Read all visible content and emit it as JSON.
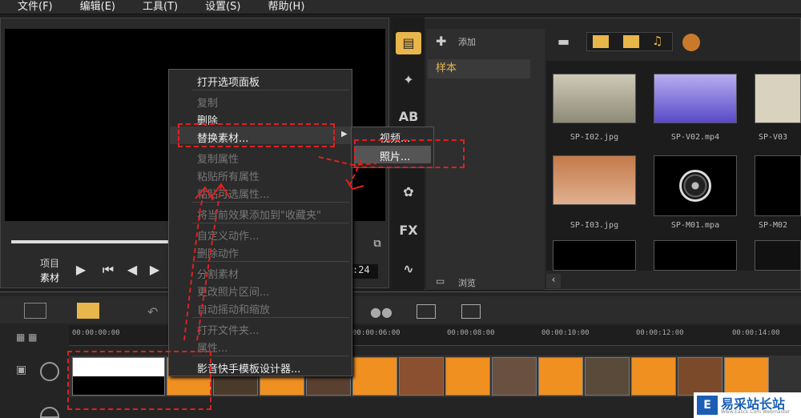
{
  "menubar": {
    "items": [
      "文件(F)",
      "编辑(E)",
      "工具(T)",
      "设置(S)",
      "帮助(H)"
    ]
  },
  "preview": {
    "project_label": "项目",
    "clip_label": "素材",
    "timecode_tail": ":24"
  },
  "library": {
    "add_label": "添加",
    "sample_label": "样本",
    "browse_label": "浏览",
    "thumbnails": [
      "SP-I02.jpg",
      "SP-V02.mp4",
      "SP-V03",
      "SP-I03.jpg",
      "SP-M01.mpa",
      "SP-M02"
    ]
  },
  "timeline": {
    "ticks": [
      "00:00:00:00",
      "00:00:06:00",
      "00:00:08:00",
      "00:00:10:00",
      "00:00:12:00",
      "00:00:14:00"
    ]
  },
  "context_menu": {
    "items": [
      {
        "label": "打开选项面板",
        "enabled": true
      },
      {
        "label": "复制",
        "enabled": false
      },
      {
        "label": "删除",
        "enabled": true
      },
      {
        "label": "替换素材...",
        "enabled": true
      },
      {
        "label": "复制属性",
        "enabled": false
      },
      {
        "label": "粘贴所有属性",
        "enabled": false
      },
      {
        "label": "粘贴可选属性...",
        "enabled": false
      },
      {
        "label": "将当前效果添加到\"收藏夹\"",
        "enabled": false
      },
      {
        "label": "自定义动作...",
        "enabled": false
      },
      {
        "label": "删除动作",
        "enabled": false
      },
      {
        "label": "分割素材",
        "enabled": false
      },
      {
        "label": "更改照片区间...",
        "enabled": false
      },
      {
        "label": "自动摇动和缩放",
        "enabled": false
      },
      {
        "label": "打开文件夹...",
        "enabled": false
      },
      {
        "label": "属性...",
        "enabled": false
      },
      {
        "label": "影音快手模板设计器...",
        "enabled": true
      }
    ],
    "submenu": [
      "视频...",
      "照片..."
    ]
  },
  "watermark": {
    "logo": "E",
    "text": "易采站长站",
    "sub": "Www.Easck.Com Webmaster"
  },
  "colors": {
    "accent_gold": "#e8b64a",
    "annotation_red": "#e02020"
  }
}
